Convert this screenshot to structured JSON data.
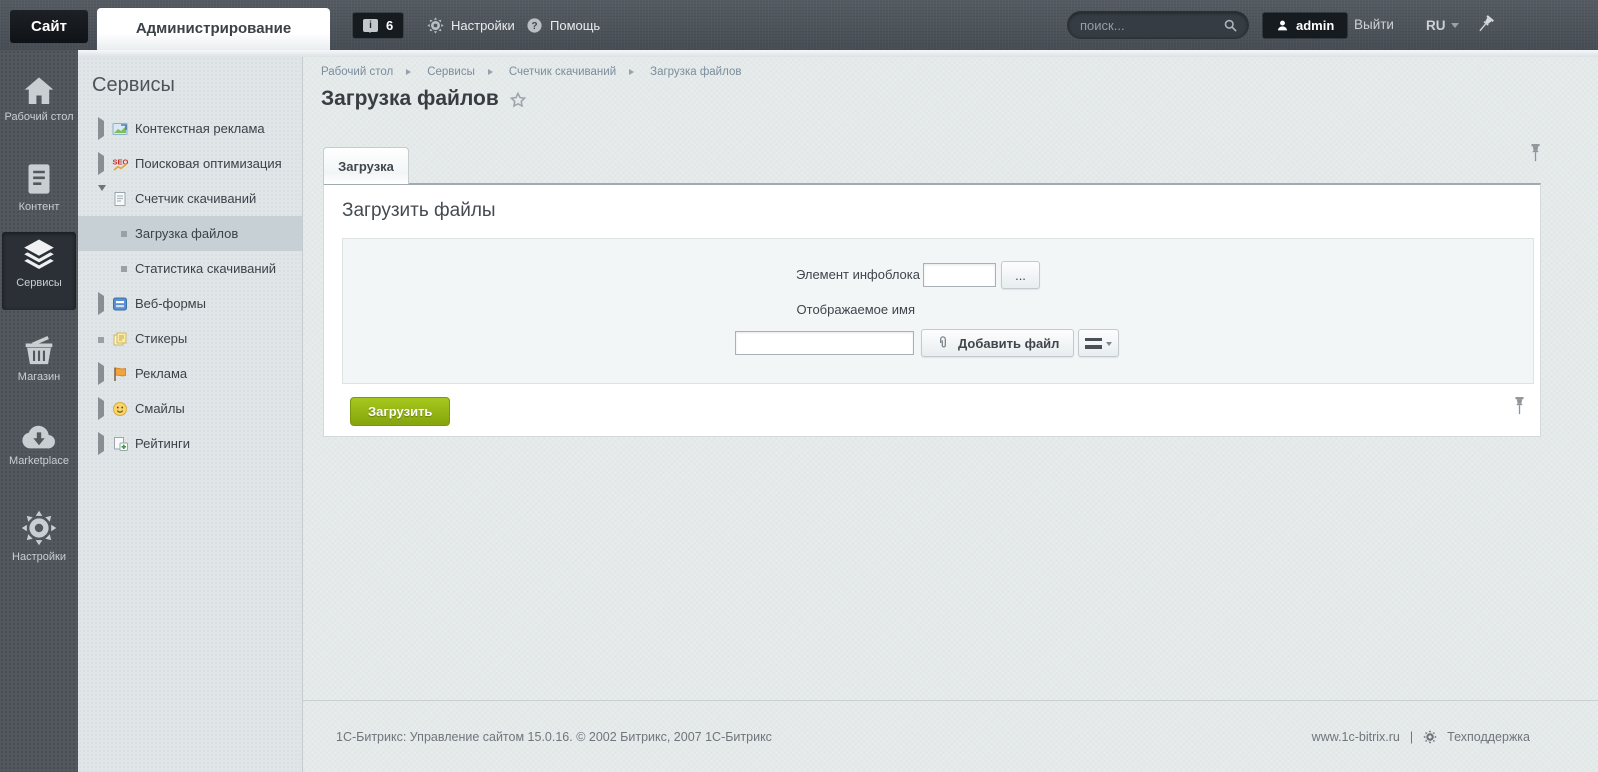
{
  "topbar": {
    "site_tab": "Сайт",
    "admin_tab": "Администрирование",
    "notifications": {
      "glyph": "i",
      "count": "6"
    },
    "settings_label": "Настройки",
    "help_label": "Помощь",
    "help_glyph": "?",
    "search": {
      "placeholder": "поиск...",
      "value": ""
    },
    "user_label": "admin",
    "logout_label": "Выйти",
    "language": "RU"
  },
  "rail": {
    "items": [
      {
        "label": "Рабочий стол",
        "icon": "home-icon",
        "active": false
      },
      {
        "label": "Контент",
        "icon": "document-icon",
        "active": false
      },
      {
        "label": "Сервисы",
        "icon": "layers-icon",
        "active": true
      },
      {
        "label": "Магазин",
        "icon": "basket-icon",
        "active": false
      },
      {
        "label": "Marketplace",
        "icon": "cloud-download-icon",
        "active": false
      },
      {
        "label": "Настройки",
        "icon": "gear-icon",
        "active": false
      }
    ]
  },
  "menu": {
    "title": "Сервисы",
    "seo_glyph": "SEO",
    "items": [
      {
        "label": "Контекстная реклама",
        "state": "collapsed",
        "icon": "contextual-ads-icon",
        "selected": false
      },
      {
        "label": "Поисковая оптимизация",
        "state": "collapsed",
        "icon": "seo-icon",
        "selected": false
      },
      {
        "label": "Счетчик скачиваний",
        "state": "expanded",
        "icon": "download-counter-icon",
        "selected": false
      },
      {
        "label": "Загрузка файлов",
        "state": "leaf",
        "level": 2,
        "selected": true
      },
      {
        "label": "Статистика скачиваний",
        "state": "leaf",
        "level": 2,
        "selected": false
      },
      {
        "label": "Веб-формы",
        "state": "collapsed",
        "icon": "web-forms-icon",
        "selected": false
      },
      {
        "label": "Стикеры",
        "state": "leaf",
        "icon": "stickers-icon",
        "selected": false
      },
      {
        "label": "Реклама",
        "state": "collapsed",
        "icon": "ads-flag-icon",
        "selected": false
      },
      {
        "label": "Смайлы",
        "state": "collapsed",
        "icon": "smiley-icon",
        "selected": false
      },
      {
        "label": "Рейтинги",
        "state": "collapsed",
        "icon": "ratings-icon",
        "selected": false
      }
    ]
  },
  "breadcrumb": {
    "items": [
      "Рабочий стол",
      "Сервисы",
      "Счетчик скачиваний",
      "Загрузка файлов"
    ]
  },
  "page": {
    "title": "Загрузка файлов",
    "tab_label": "Загрузка",
    "section_title": "Загрузить файлы",
    "form": {
      "infoblock_label": "Элемент инфоблока",
      "infoblock_value": "",
      "browse_label": "...",
      "display_name_label": "Отображаемое имя",
      "file_value": "",
      "add_file_label": "Добавить файл",
      "submit_label": "Загрузить"
    }
  },
  "footer": {
    "copyright": "1С-Битрикс: Управление сайтом 15.0.16. © 2002 Битрикс, 2007 1С-Битрикс",
    "site_link": "www.1c-bitrix.ru",
    "separator": "|",
    "support_link": "Техподдержка"
  },
  "colors": {
    "accent_green": "#90b017",
    "topbar_bg": "#4e545b",
    "rail_bg": "#53585f",
    "menu_bg": "#e0e5e8",
    "selected_menu_bg": "#c7d0d5",
    "content_bg": "#e4e9ea"
  }
}
